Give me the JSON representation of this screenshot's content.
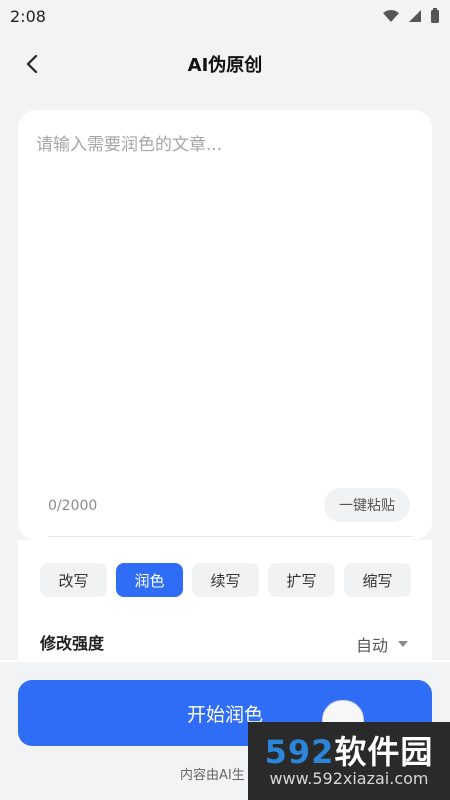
{
  "status_bar": {
    "time": "2:08",
    "icons": [
      "wifi-icon",
      "signal-icon",
      "battery-icon"
    ]
  },
  "header": {
    "title": "AI伪原创",
    "back_icon": "back-arrow-icon"
  },
  "editor": {
    "placeholder": "请输入需要润色的文章...",
    "counter": "0/2000",
    "paste_label": "一键粘贴"
  },
  "modes": {
    "items": [
      "改写",
      "润色",
      "续写",
      "扩写",
      "缩写"
    ],
    "active": "润色"
  },
  "strength": {
    "label": "修改强度",
    "value": "自动"
  },
  "actions": {
    "start_label": "开始润色"
  },
  "footer": {
    "note": "内容由AI生"
  },
  "watermark": {
    "brand_num": "592",
    "brand_text": "软件园",
    "url": "www.592xiazai.com"
  },
  "colors": {
    "accent": "#2f6df6",
    "background": "#f2f3f5"
  }
}
